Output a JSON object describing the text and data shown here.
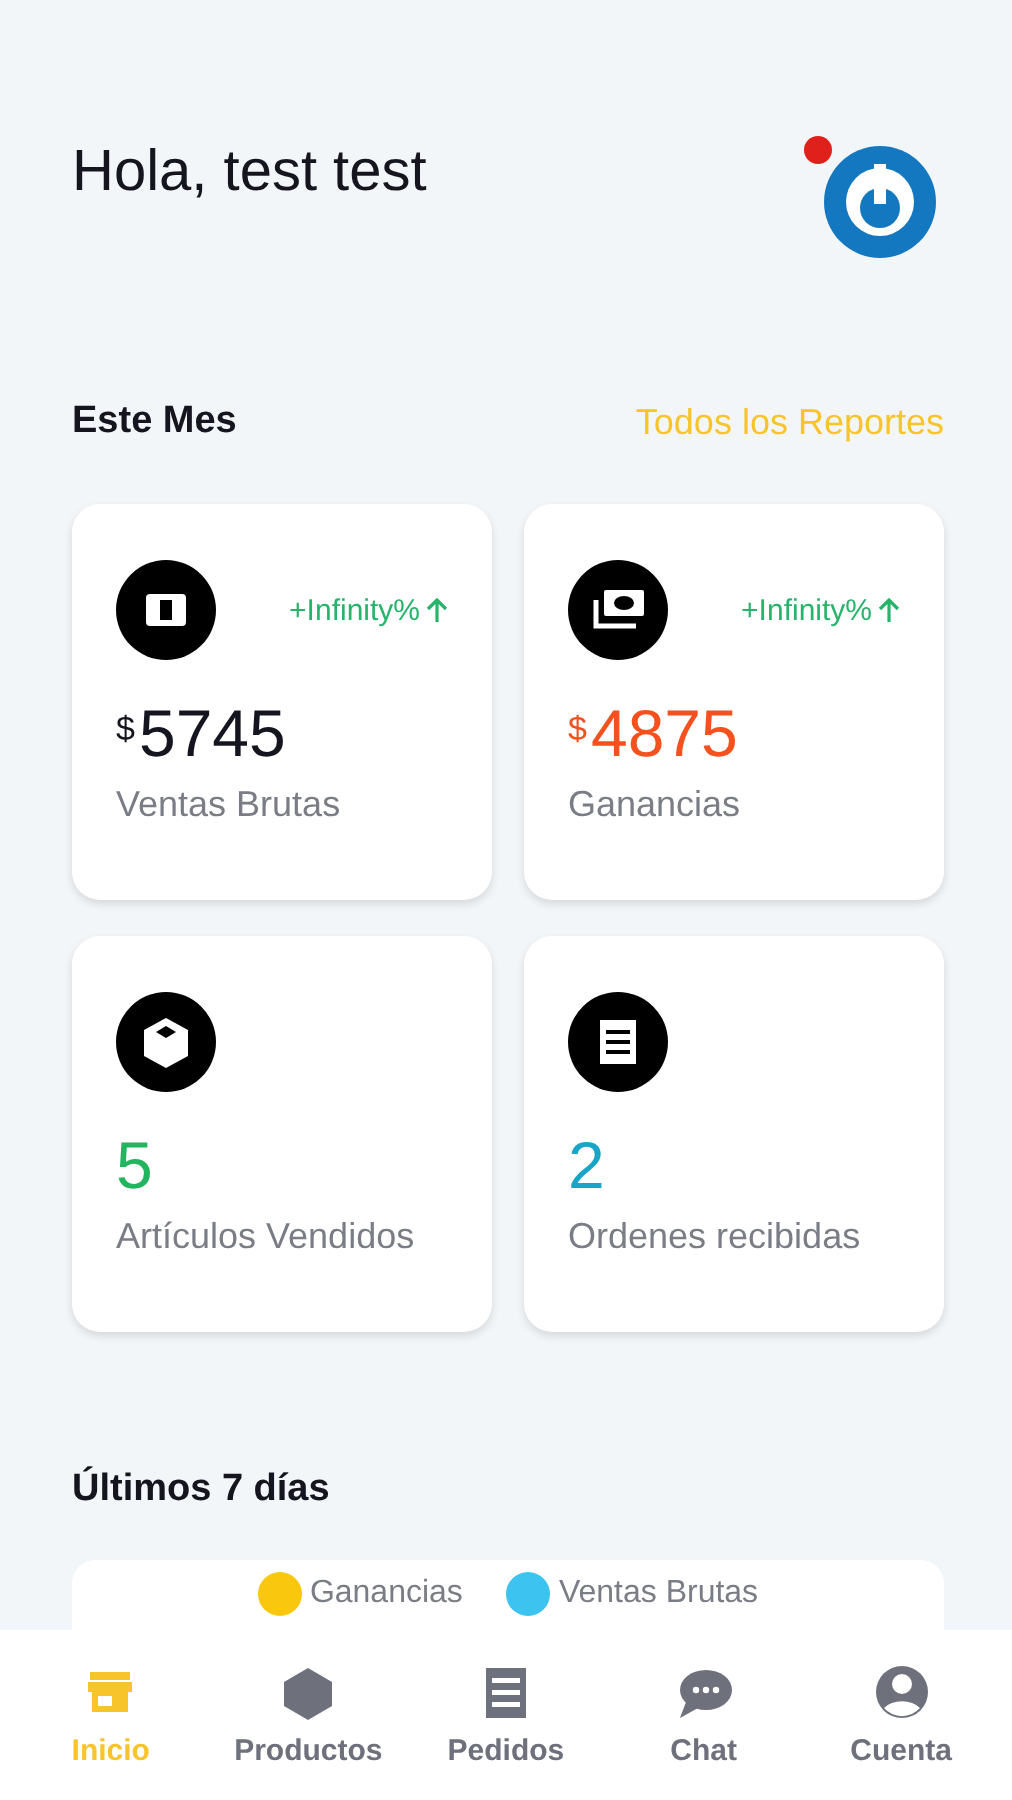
{
  "greeting": "Hola, test test",
  "month_section": {
    "title": "Este Mes",
    "link": "Todos los Reportes"
  },
  "stats": [
    {
      "kind": "money",
      "currency": "$",
      "value": "5745",
      "label": "Ventas Brutas",
      "trend": "+Infinity%",
      "color": "#15151f"
    },
    {
      "kind": "money",
      "currency": "$",
      "value": "4875",
      "label": "Ganancias",
      "trend": "+Infinity%",
      "color": "#f4511e"
    },
    {
      "kind": "count",
      "value": "5",
      "label": "Artículos Vendidos",
      "color": "#22b45e"
    },
    {
      "kind": "count",
      "value": "2",
      "label": "Ordenes recibidas",
      "color": "#1aa5c8"
    }
  ],
  "week_section": {
    "title": "Últimos 7 días",
    "legend": [
      {
        "label": "Ganancias",
        "color": "#f9c80e"
      },
      {
        "label": "Ventas Brutas",
        "color": "#3cc3ef"
      }
    ]
  },
  "nav": [
    {
      "label": "Inicio",
      "selected": true
    },
    {
      "label": "Productos",
      "selected": false
    },
    {
      "label": "Pedidos",
      "selected": false
    },
    {
      "label": "Chat",
      "selected": false
    },
    {
      "label": "Cuenta",
      "selected": false
    }
  ]
}
